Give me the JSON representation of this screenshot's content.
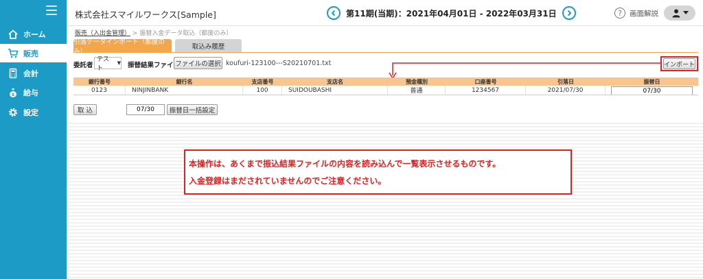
{
  "sidebar": {
    "items": [
      {
        "label": "ホーム",
        "icon": "home-icon"
      },
      {
        "label": "販売",
        "icon": "cart-icon"
      },
      {
        "label": "会計",
        "icon": "calculator-icon"
      },
      {
        "label": "給与",
        "icon": "money-bag-icon"
      },
      {
        "label": "設定",
        "icon": "gear-icon"
      }
    ],
    "active_index": 1,
    "bg_color": "#1b9bc5"
  },
  "header": {
    "company": "株式会社スマイルワークス[Sample]",
    "period": "第11期(当期)：2021年04月01日 - 2022年03月31日",
    "help_label": "画面解説"
  },
  "breadcrumb": {
    "link": "販売（入出金管理）",
    "separator": ">",
    "current": "振替入金データ取込（都度のみ）"
  },
  "tabs": [
    {
      "label": "引落データインポート（都度のみ）",
      "active": true
    },
    {
      "label": "取込み履歴",
      "active": false
    }
  ],
  "form": {
    "client_label": "委託者",
    "client_value": "テスト",
    "result_file_label": "振替結果ファイル",
    "file_button": "ファイルの選択",
    "file_name": "koufuri-123100---S20210701.txt",
    "import_button": "インポート"
  },
  "table": {
    "headers": [
      "銀行番号",
      "銀行名",
      "支店番号",
      "支店名",
      "預金種別",
      "口座番号",
      "引落日",
      "振替日"
    ],
    "rows": [
      {
        "bank_no": "0123",
        "bank_name": "NINJINBANK",
        "branch_no": "100",
        "branch_name": "SUIDOUBASHI",
        "deposit_type": "普通",
        "account_no": "1234567",
        "debit_date": "2021/07/30",
        "transfer_date": "07/30"
      }
    ]
  },
  "actions": {
    "torikomi_button": "取 込",
    "date_value": "07/30",
    "batch_button": "振替日一括設定"
  },
  "notice": {
    "line1": "本操作は、あくまで振込結果ファイルの内容を読み込んで一覧表示させるものです。",
    "line2": "入金登録はまだされていませんのでご注意ください。"
  },
  "colors": {
    "accent": "#1b9bc5",
    "tab_active": "#f4a64c",
    "table_header": "#f7c690",
    "alert": "#e02020"
  }
}
